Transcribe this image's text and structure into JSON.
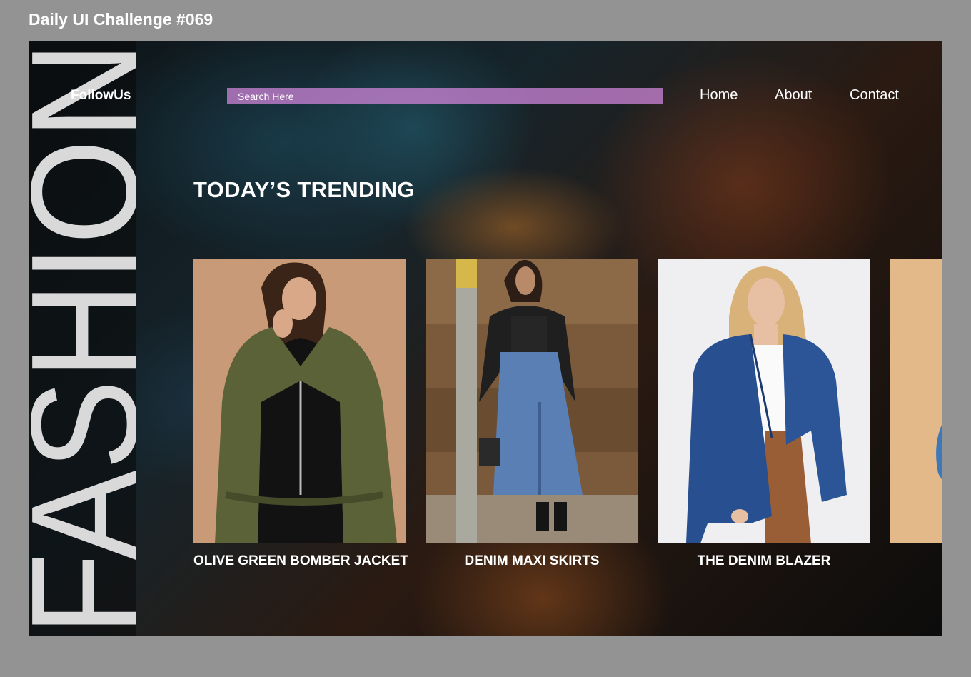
{
  "challenge_title": "Daily UI Challenge #069",
  "brand": {
    "vertical_word": "FASHION"
  },
  "nav": {
    "follow_us": "FollowUs",
    "search_placeholder": "Search Here",
    "links": [
      "Home",
      "About",
      "Contact"
    ]
  },
  "section_title": "TODAY’S TRENDING",
  "products": [
    {
      "name": "OLIVE GREEN BOMBER JACKET"
    },
    {
      "name": "DENIM MAXI SKIRTS"
    },
    {
      "name": "THE DENIM BLAZER"
    }
  ],
  "colors": {
    "page_background": "#939393",
    "search_bar": "#c882d2",
    "text": "#ffffff",
    "vertical_word": "#d9d9d9"
  }
}
